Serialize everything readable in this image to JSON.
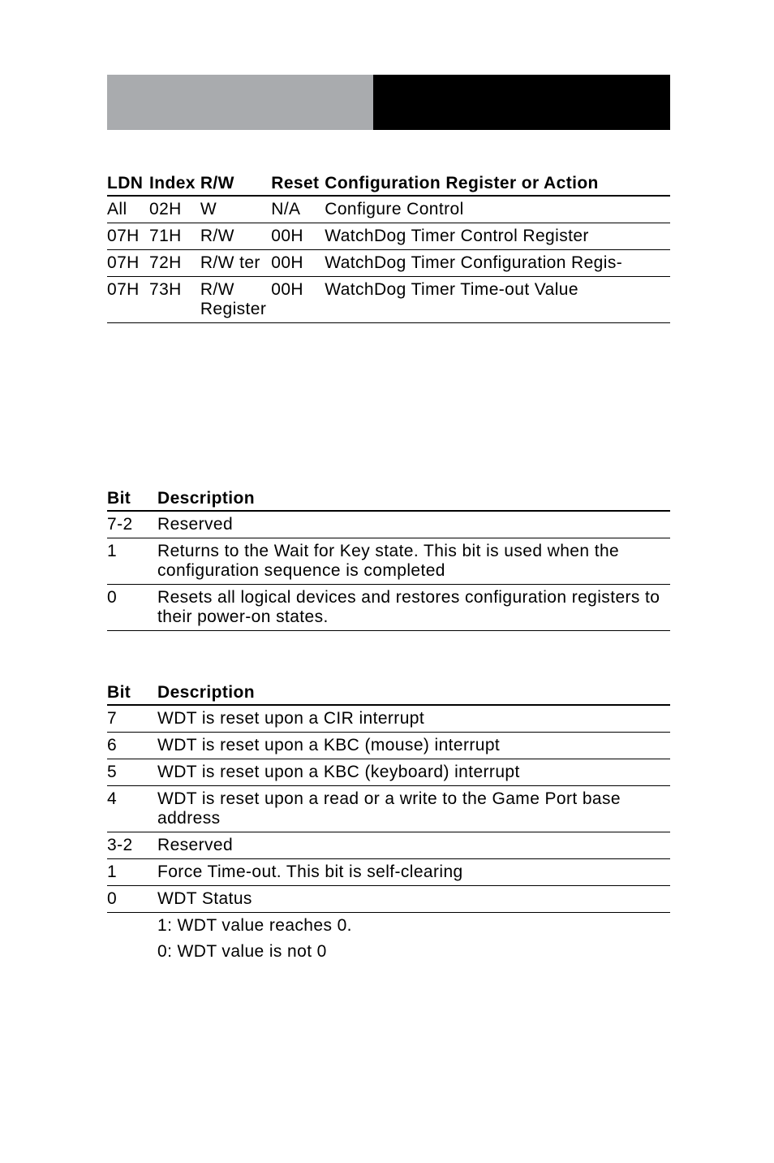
{
  "table1": {
    "headers": [
      "LDN",
      "Index",
      "R/W",
      "Reset",
      "Configuration Register or Action"
    ],
    "rows": [
      {
        "ldn": "All",
        "index": "02H",
        "rw": "W",
        "reset": "N/A",
        "desc": "Configure Control"
      },
      {
        "ldn": "07H",
        "index": "71H",
        "rw": "R/W",
        "reset": "00H",
        "desc": "WatchDog Timer Control Register"
      },
      {
        "ldn": "07H",
        "index": "72H",
        "rw": "R/W ter",
        "reset": "00H",
        "desc": "WatchDog Timer Configuration Regis-"
      },
      {
        "ldn": "07H",
        "index": "73H",
        "rw": "R/W Register",
        "reset": "00H",
        "desc": "WatchDog Timer Time-out Value"
      }
    ]
  },
  "table2": {
    "headers": [
      "Bit",
      "Description"
    ],
    "rows": [
      {
        "bit": "7-2",
        "desc": "Reserved"
      },
      {
        "bit": "1",
        "desc": "Returns to the Wait for Key state. This bit is used when the configuration sequence is completed"
      },
      {
        "bit": "0",
        "desc": "Resets all logical devices and restores configuration registers to their power-on states."
      }
    ]
  },
  "table3": {
    "headers": [
      "Bit",
      "Description"
    ],
    "rows": [
      {
        "bit": "7",
        "desc": "WDT is reset upon a CIR interrupt"
      },
      {
        "bit": "6",
        "desc": "WDT is reset upon a KBC (mouse) interrupt"
      },
      {
        "bit": "5",
        "desc": "WDT is reset upon a KBC (keyboard) interrupt"
      },
      {
        "bit": "4",
        "desc": "WDT is reset upon a read or a write to the Game Port base address"
      },
      {
        "bit": "3-2",
        "desc": "Reserved"
      },
      {
        "bit": "1",
        "desc": "Force Time-out. This bit is self-clearing"
      },
      {
        "bit": "0",
        "desc": "WDT Status"
      }
    ],
    "extra": [
      "1: WDT value reaches 0.",
      "0: WDT value is not 0"
    ]
  }
}
